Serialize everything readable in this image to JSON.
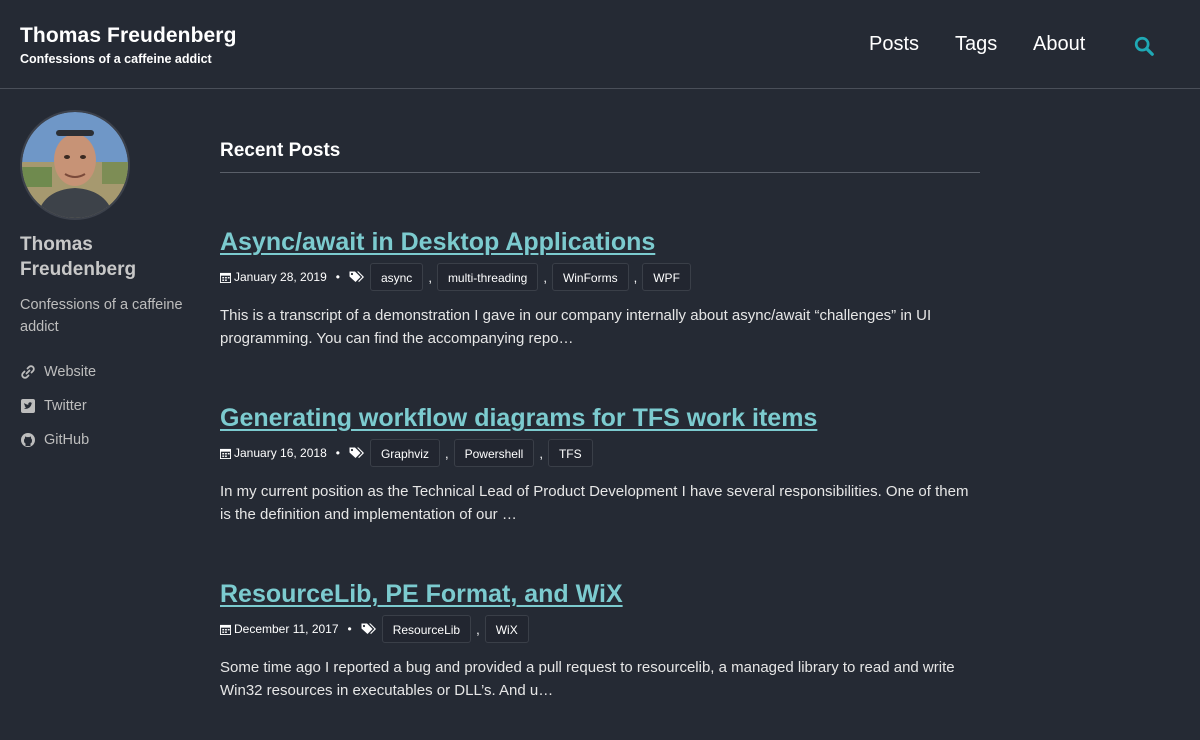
{
  "site": {
    "title": "Thomas Freudenberg",
    "tagline": "Confessions of a caffeine addict"
  },
  "nav": {
    "items": [
      "Posts",
      "Tags",
      "About"
    ],
    "search_icon": "search-icon",
    "accent": "#1fa9b5"
  },
  "sidebar": {
    "name": "Thomas Freudenberg",
    "bio": "Confessions of a caffeine addict",
    "links": [
      {
        "label": "Website",
        "icon": "link-icon"
      },
      {
        "label": "Twitter",
        "icon": "twitter-icon"
      },
      {
        "label": "GitHub",
        "icon": "github-icon"
      }
    ]
  },
  "main": {
    "section_title": "Recent Posts",
    "posts": [
      {
        "title": "Async/await in Desktop Applications",
        "date": "January 28, 2019",
        "tags": [
          "async",
          "multi-threading",
          "WinForms",
          "WPF"
        ],
        "excerpt": "This is a transcript of a demonstration I gave in our company internally about async/await “challenges” in UI programming. You can find the accompanying repo…"
      },
      {
        "title": "Generating workflow diagrams for TFS work items",
        "date": "January 16, 2018",
        "tags": [
          "Graphviz",
          "Powershell",
          "TFS"
        ],
        "excerpt": "In my current position as the Technical Lead of Product Development I have several responsibilities. One of them is the definition and implementation of our …"
      },
      {
        "title": "ResourceLib, PE Format, and WiX",
        "date": "December 11, 2017",
        "tags": [
          "ResourceLib",
          "WiX"
        ],
        "excerpt": "Some time ago I reported a bug and provided a pull request to resourcelib, a managed library to read and write Win32 resources in executables or DLL’s. And u…"
      }
    ]
  },
  "colors": {
    "background": "#252a34",
    "link": "#7ccbcf",
    "accent": "#1fa9b5"
  }
}
